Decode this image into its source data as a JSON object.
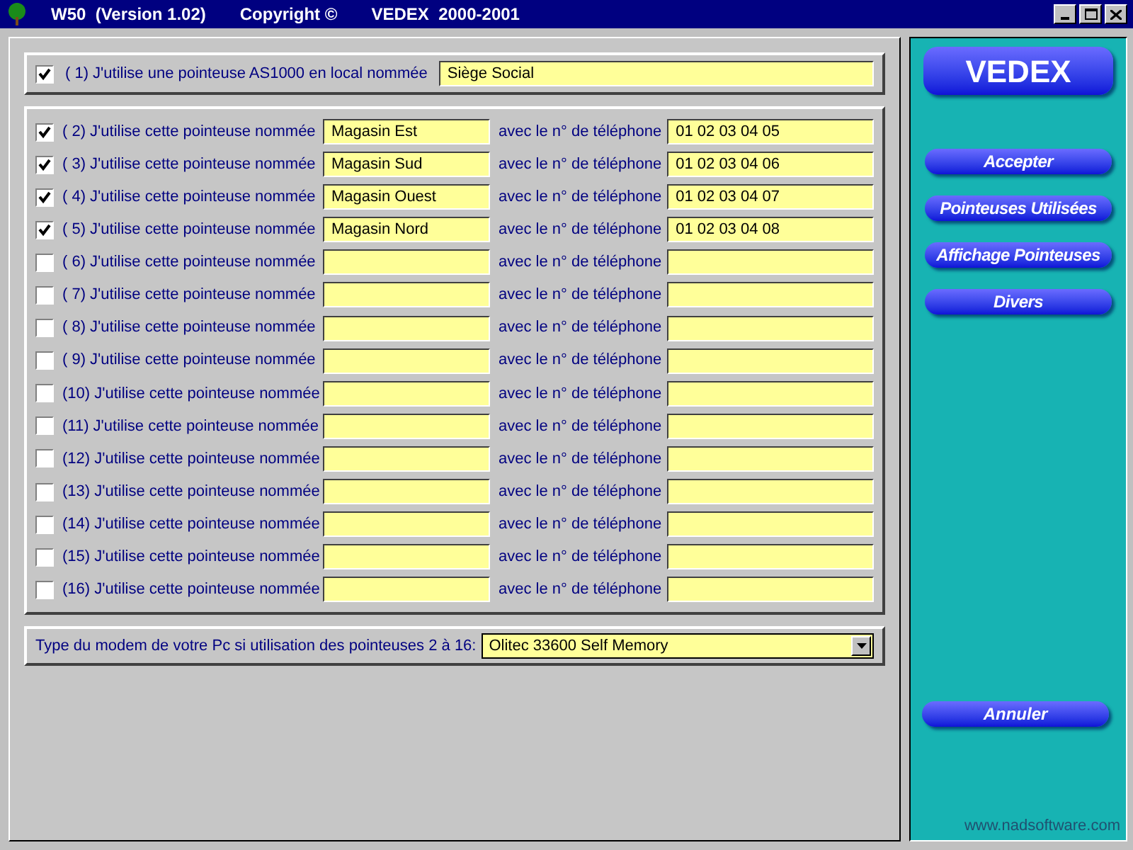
{
  "window": {
    "title_parts": [
      "W50  (Version 1.02)",
      "Copyright ©",
      "VEDEX  2000-2001"
    ]
  },
  "local": {
    "checked": true,
    "label": "( 1) J'utilise une pointeuse AS1000 en local nommée",
    "value": "Siège Social"
  },
  "remotes": [
    {
      "checked": true,
      "label": "( 2) J'utilise cette pointeuse nommée",
      "name": "Magasin Est",
      "phone_label": "avec le n° de téléphone",
      "phone": "01 02 03 04 05"
    },
    {
      "checked": true,
      "label": "( 3) J'utilise cette pointeuse nommée",
      "name": "Magasin Sud",
      "phone_label": "avec le n° de téléphone",
      "phone": "01 02 03 04 06"
    },
    {
      "checked": true,
      "label": "( 4) J'utilise cette pointeuse nommée",
      "name": "Magasin Ouest",
      "phone_label": "avec le n° de téléphone",
      "phone": "01 02 03 04 07"
    },
    {
      "checked": true,
      "label": "( 5) J'utilise cette pointeuse nommée",
      "name": "Magasin Nord",
      "phone_label": "avec le n° de téléphone",
      "phone": "01 02 03 04 08"
    },
    {
      "checked": false,
      "label": "( 6) J'utilise cette pointeuse nommée",
      "phone_label": "avec le n° de téléphone"
    },
    {
      "checked": false,
      "label": "( 7) J'utilise cette pointeuse nommée",
      "phone_label": "avec le n° de téléphone"
    },
    {
      "checked": false,
      "label": "( 8) J'utilise cette pointeuse nommée",
      "phone_label": "avec le n° de téléphone"
    },
    {
      "checked": false,
      "label": "( 9) J'utilise cette pointeuse nommée",
      "phone_label": "avec le n° de téléphone"
    },
    {
      "checked": false,
      "label": "(10) J'utilise cette pointeuse nommée",
      "phone_label": "avec le n° de téléphone"
    },
    {
      "checked": false,
      "label": "(11) J'utilise cette pointeuse nommée",
      "phone_label": "avec le n° de téléphone"
    },
    {
      "checked": false,
      "label": "(12) J'utilise cette pointeuse nommée",
      "phone_label": "avec le n° de téléphone"
    },
    {
      "checked": false,
      "label": "(13) J'utilise cette pointeuse nommée",
      "phone_label": "avec le n° de téléphone"
    },
    {
      "checked": false,
      "label": "(14) J'utilise cette pointeuse nommée",
      "phone_label": "avec le n° de téléphone"
    },
    {
      "checked": false,
      "label": "(15) J'utilise cette pointeuse nommée",
      "phone_label": "avec le n° de téléphone"
    },
    {
      "checked": false,
      "label": "(16) J'utilise cette pointeuse nommée",
      "phone_label": "avec le n° de téléphone"
    }
  ],
  "modem": {
    "label": "Type du modem de votre Pc si utilisation des pointeuses 2 à 16:",
    "value": "Olitec 33600 Self Memory"
  },
  "sidebar": {
    "logo": "VEDEX",
    "buttons": [
      "Accepter",
      "Pointeuses Utilisées",
      "Affichage Pointeuses",
      "Divers"
    ],
    "cancel": "Annuler",
    "url": "www.nadsoftware.com"
  }
}
